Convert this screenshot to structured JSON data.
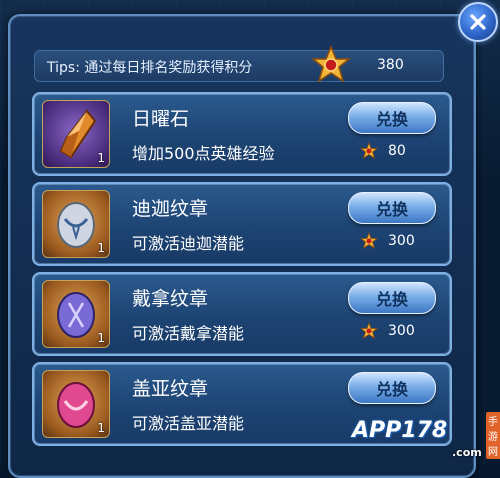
{
  "tips": {
    "text": "Tips: 通过每日排名奖励获得积分",
    "points": "380",
    "icon": "gold-star-icon"
  },
  "items": [
    {
      "name": "日曜石",
      "desc": "增加500点英雄经验",
      "count": "1",
      "button": "兑换",
      "cost": "80",
      "icon": "orange-crystal-icon",
      "bg": "purple"
    },
    {
      "name": "迪迦纹章",
      "desc": "可激活迪迦潜能",
      "count": "1",
      "button": "兑换",
      "cost": "300",
      "icon": "silver-emblem-icon",
      "bg": "orange"
    },
    {
      "name": "戴拿纹章",
      "desc": "可激活戴拿潜能",
      "count": "1",
      "button": "兑换",
      "cost": "300",
      "icon": "purple-emblem-icon",
      "bg": "orange"
    },
    {
      "name": "盖亚纹章",
      "desc": "可激活盖亚潜能",
      "count": "1",
      "button": "兑换",
      "cost": "",
      "icon": "pink-emblem-icon",
      "bg": "orange"
    }
  ],
  "watermark": {
    "brand": "APP178",
    "site": ".com",
    "tag": "手游网"
  },
  "colors": {
    "panel": "#17355d",
    "accent_gold": "#f2b53a",
    "button_blue": "#7aaee8"
  }
}
